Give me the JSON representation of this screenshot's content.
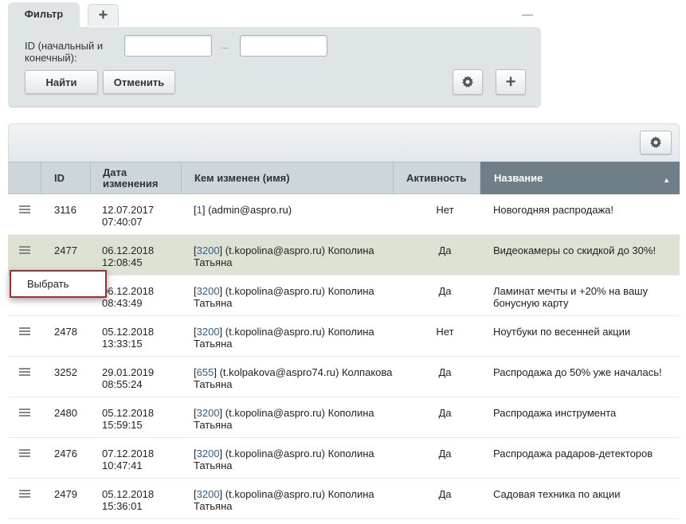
{
  "filter": {
    "tab_label": "Фильтр",
    "add_tab_label": "+",
    "id_label": "ID (начальный и конечный):",
    "id_from": "",
    "id_to": "",
    "range_separator": "...",
    "find_label": "Найти",
    "cancel_label": "Отменить",
    "add_icon": "+"
  },
  "grid": {
    "columns": {
      "id": "ID",
      "date": "Дата изменения",
      "author": "Кем изменен (имя)",
      "active": "Активность",
      "name": "Название"
    },
    "rows": [
      {
        "id": "3116",
        "date": "12.07.2017",
        "time": "07:40:07",
        "uid": "1",
        "author_line1": " (admin@aspro.ru)",
        "author_line2": "",
        "active": "Нет",
        "name": "Новогодняя распродажа!"
      },
      {
        "id": "2477",
        "date": "06.12.2018",
        "time": "12:08:45",
        "uid": "3200",
        "author_line1": " (t.kopolina@aspro.ru) Кополина",
        "author_line2": "Татьяна",
        "active": "Да",
        "name": "Видеокамеры со скидкой до 30%!"
      },
      {
        "id": "",
        "date": "06.12.2018",
        "time": "08:43:49",
        "uid": "3200",
        "author_line1": " (t.kopolina@aspro.ru) Кополина",
        "author_line2": "Татьяна",
        "active": "Да",
        "name": "Ламинат мечты и +20% на вашу бонусную карту"
      },
      {
        "id": "2478",
        "date": "05.12.2018",
        "time": "13:33:15",
        "uid": "3200",
        "author_line1": " (t.kopolina@aspro.ru) Кополина",
        "author_line2": "Татьяна",
        "active": "Нет",
        "name": "Ноутбуки по весенней акции"
      },
      {
        "id": "3252",
        "date": "29.01.2019",
        "time": "08:55:24",
        "uid": "655",
        "author_line1": " (t.kolpakova@aspro74.ru) Колпакова",
        "author_line2": "Татьяна",
        "active": "Да",
        "name": "Распродажа до 50% уже началась!"
      },
      {
        "id": "2480",
        "date": "05.12.2018",
        "time": "15:59:15",
        "uid": "3200",
        "author_line1": " (t.kopolina@aspro.ru) Кополина",
        "author_line2": "Татьяна",
        "active": "Да",
        "name": "Распродажа инструмента"
      },
      {
        "id": "2476",
        "date": "07.12.2018",
        "time": "10:47:41",
        "uid": "3200",
        "author_line1": " (t.kopolina@aspro.ru) Кополина",
        "author_line2": "Татьяна",
        "active": "Да",
        "name": "Распродажа радаров-детекторов"
      },
      {
        "id": "2479",
        "date": "05.12.2018",
        "time": "15:36:01",
        "uid": "3200",
        "author_line1": " (t.kopolina@aspro.ru) Кополина",
        "author_line2": "Татьяна",
        "active": "Да",
        "name": "Садовая техника по акции"
      }
    ]
  },
  "context_menu": {
    "select_label": "Выбрать"
  },
  "colors": {
    "sorted_header": "#6f7f88",
    "highlight_row": "#dee2d3",
    "menu_border": "#a72e2e",
    "link": "#2b5d9c"
  }
}
